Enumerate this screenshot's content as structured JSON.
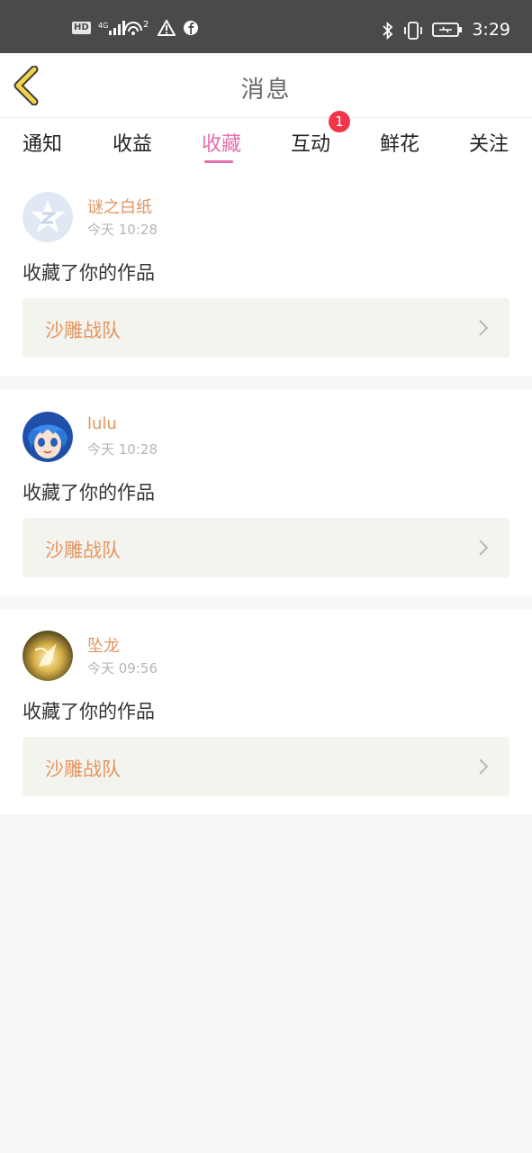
{
  "status_bar": {
    "left_icons": [
      "hd-badge",
      "4g-signal-icon",
      "wifi-hotspot-icon",
      "warning-icon",
      "facebook-icon"
    ],
    "hd_label": "HD",
    "network_label": "4G",
    "hotspot_count": "2",
    "right_icons": [
      "bluetooth-icon",
      "vibrate-icon",
      "battery-charging-icon"
    ],
    "time": "3:29"
  },
  "header": {
    "title": "消息"
  },
  "tabs": {
    "items": [
      {
        "label": "通知"
      },
      {
        "label": "收益"
      },
      {
        "label": "收藏"
      },
      {
        "label": "互动"
      },
      {
        "label": "鲜花"
      },
      {
        "label": "关注"
      }
    ],
    "active": "收藏",
    "interaction_badge": "1"
  },
  "feed": [
    {
      "user": "谜之白纸",
      "time": "今天 10:28",
      "action": "收藏了你的作品",
      "work": "沙雕战队",
      "avatar": "qq-star-avatar"
    },
    {
      "user": "lulu",
      "time": "今天 10:28",
      "action": "收藏了你的作品",
      "work": "沙雕战队",
      "avatar": "anime-girl-avatar"
    },
    {
      "user": "坠龙",
      "time": "今天 09:56",
      "action": "收藏了你的作品",
      "work": "沙雕战队",
      "avatar": "golden-dragon-avatar"
    }
  ],
  "colors": {
    "accent": "#e56fae",
    "name_orange": "#e39560",
    "badge_red": "#f2354a",
    "work_bg": "#f4f4ee",
    "status_bar": "#4a4a4a"
  }
}
